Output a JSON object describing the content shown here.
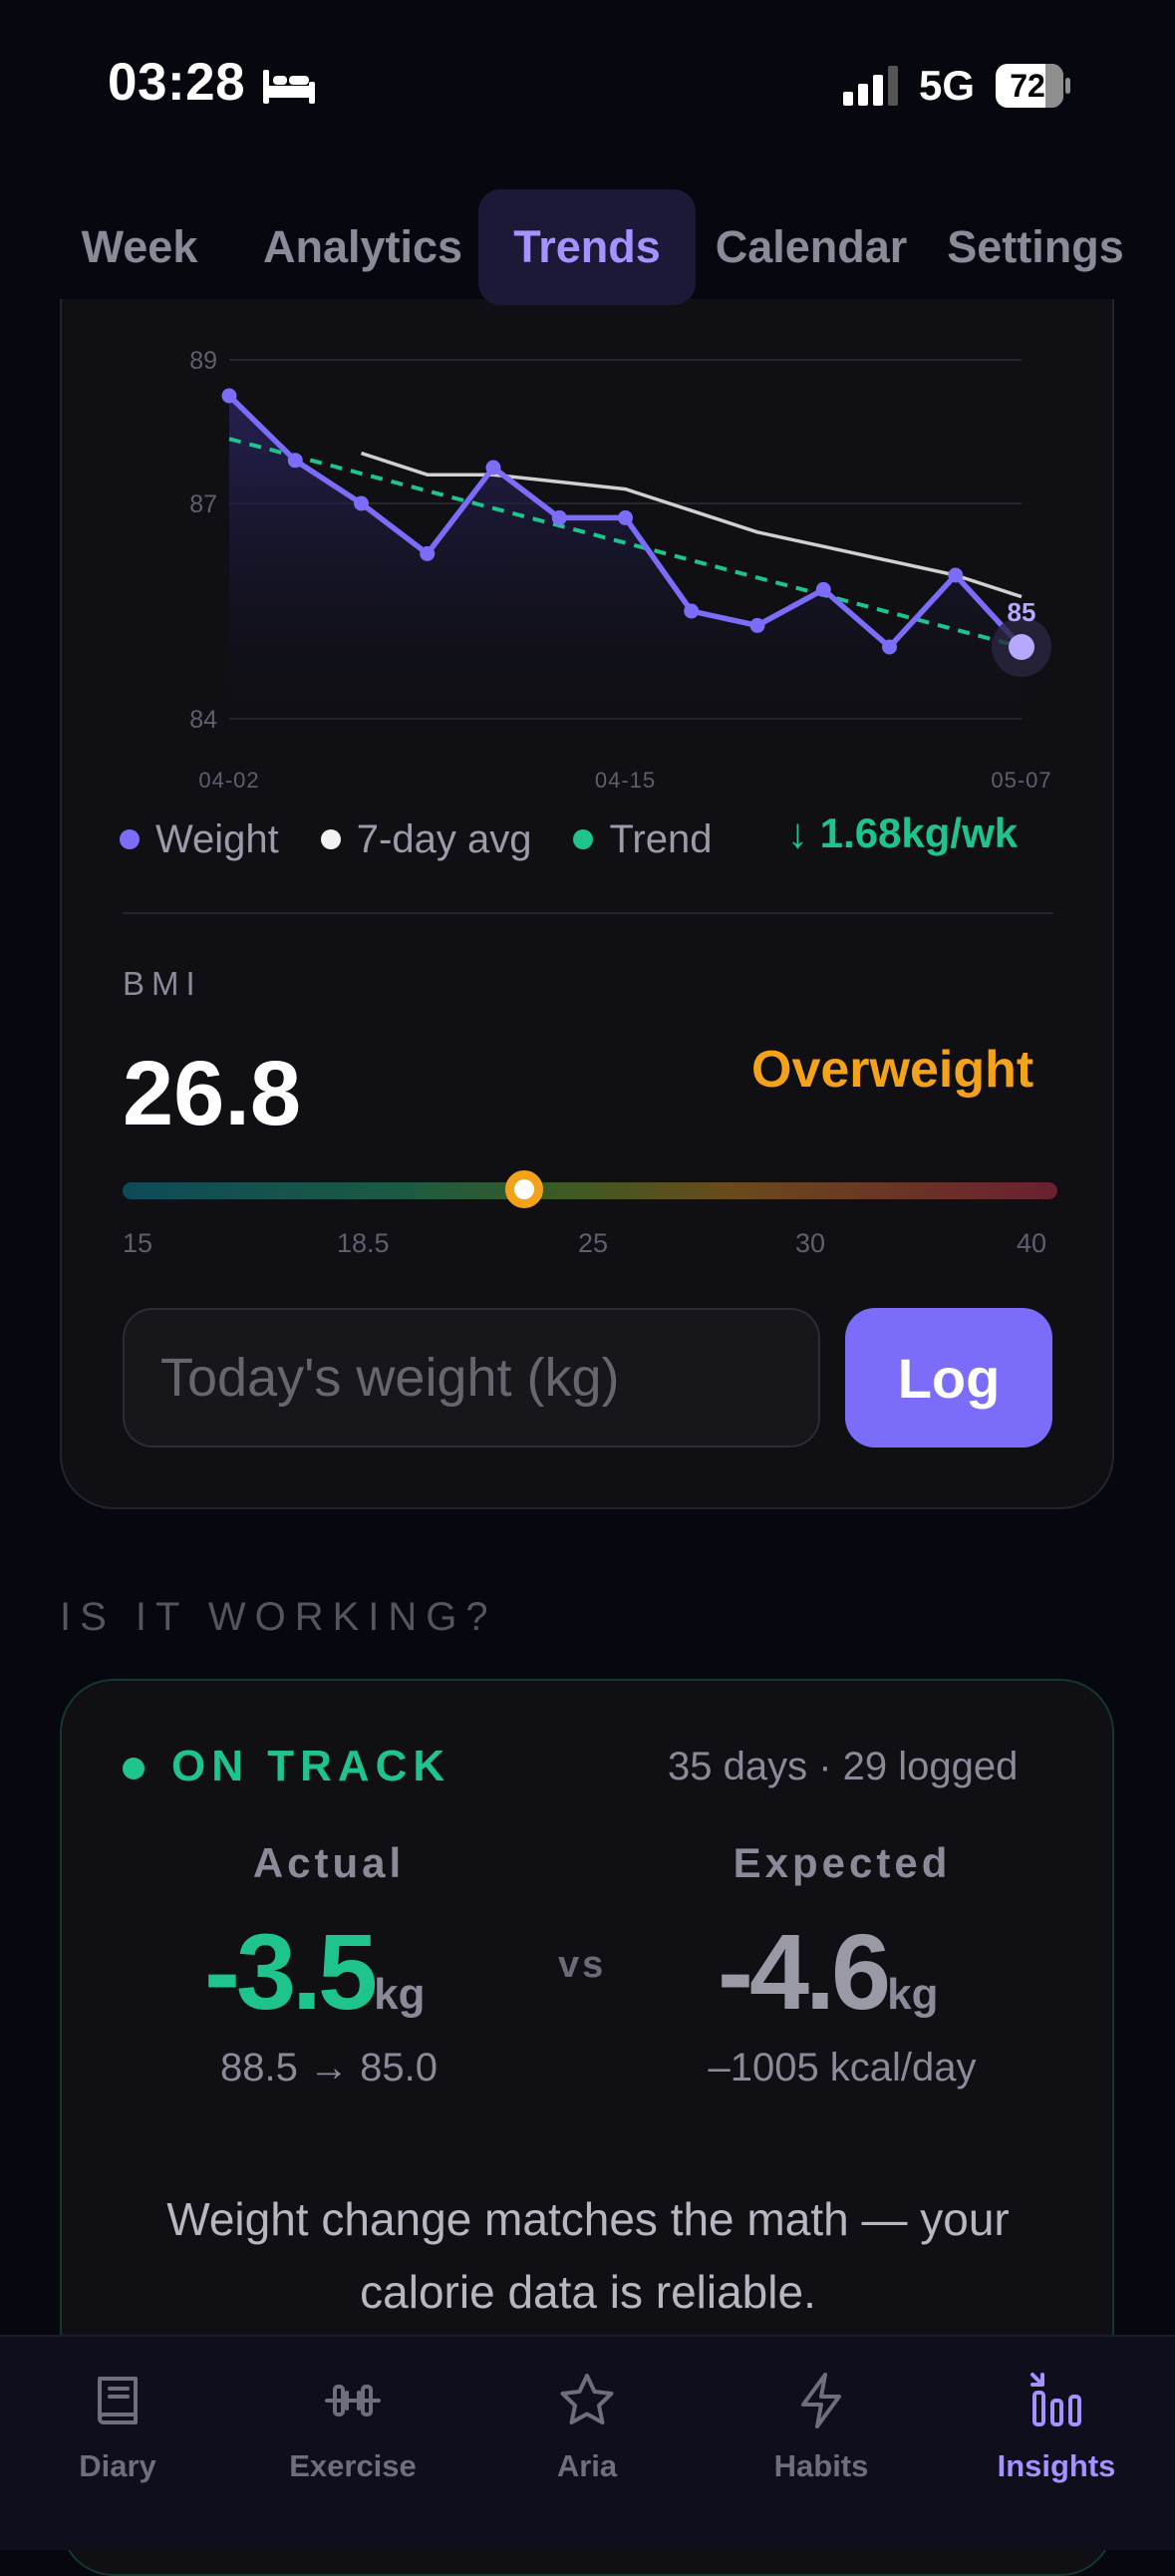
{
  "status_bar": {
    "time": "03:28",
    "network": "5G",
    "battery": "72"
  },
  "tabs": [
    {
      "label": "Week",
      "active": false
    },
    {
      "label": "Analytics",
      "active": false
    },
    {
      "label": "Trends",
      "active": true
    },
    {
      "label": "Calendar",
      "active": false
    },
    {
      "label": "Settings",
      "active": false
    }
  ],
  "chart_data": {
    "type": "line",
    "x_ticks": [
      "04-02",
      "04-15",
      "05-07"
    ],
    "y_ticks": [
      89,
      87,
      84
    ],
    "ylim": [
      84,
      89
    ],
    "series": [
      {
        "name": "Weight",
        "color": "#7c6cfa",
        "x": [
          0,
          1,
          2,
          3,
          4,
          5,
          6,
          7,
          8,
          9,
          10,
          11,
          12
        ],
        "values": [
          88.5,
          87.6,
          87.0,
          86.3,
          87.5,
          86.8,
          86.8,
          85.5,
          85.3,
          85.8,
          85.0,
          86.0,
          85.0
        ]
      },
      {
        "name": "7-day avg",
        "color": "#d0d0d0",
        "x": [
          2,
          3,
          4,
          5,
          6,
          7,
          8,
          9,
          10,
          11,
          12
        ],
        "values": [
          87.7,
          87.4,
          87.4,
          87.3,
          87.2,
          86.9,
          86.6,
          86.4,
          86.2,
          86.0,
          85.7
        ]
      },
      {
        "name": "Trend",
        "color": "#1fc48d",
        "style": "dashed",
        "x": [
          0,
          12
        ],
        "values": [
          87.9,
          85.0
        ]
      }
    ],
    "end_label": "85",
    "trend_rate": "↓ 1.68kg/wk"
  },
  "bmi": {
    "label": "BMI",
    "value": "26.8",
    "category": "Overweight",
    "ticks": [
      "15",
      "18.5",
      "25",
      "30",
      "40"
    ],
    "position_fraction": 0.43
  },
  "log": {
    "placeholder": "Today's weight (kg)",
    "button": "Log"
  },
  "working": {
    "heading": "IS IT WORKING?",
    "status": "ON TRACK",
    "days": "35 days · 29 logged",
    "actual_label": "Actual",
    "actual_value": "-3.5",
    "actual_unit": "kg",
    "actual_sub": "88.5 → 85.0",
    "vs": "vs",
    "expected_label": "Expected",
    "expected_value": "-4.6",
    "expected_unit": "kg",
    "expected_sub": "–1005 kcal/day",
    "message": "Weight change matches the math — your calorie data is reliable."
  },
  "nav": [
    {
      "label": "Diary",
      "icon": "book-icon"
    },
    {
      "label": "Exercise",
      "icon": "dumbbell-icon"
    },
    {
      "label": "Aria",
      "icon": "star-icon"
    },
    {
      "label": "Habits",
      "icon": "lightning-icon"
    },
    {
      "label": "Insights",
      "icon": "bar-chart-icon",
      "active": true
    }
  ],
  "colors": {
    "accent": "#7c6cfa",
    "success": "#1fc48d",
    "warning": "#f5a21b"
  }
}
